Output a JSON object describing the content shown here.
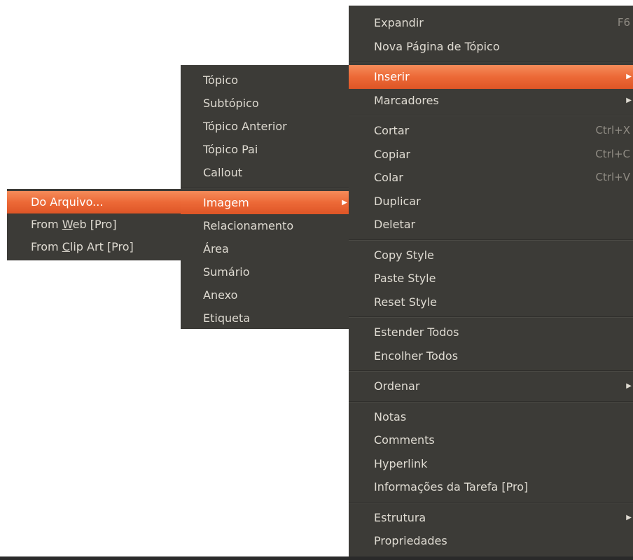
{
  "main_menu": {
    "items": [
      {
        "label": "Expandir",
        "shortcut": "F6"
      },
      {
        "label": "Nova Página de Tópico",
        "shortcut": ""
      },
      {
        "label": "Inserir",
        "submenu": true,
        "active": true
      },
      {
        "label": "Marcadores",
        "submenu": true
      },
      {
        "label": "Cortar",
        "shortcut": "Ctrl+X"
      },
      {
        "label": "Copiar",
        "shortcut": "Ctrl+C"
      },
      {
        "label": "Colar",
        "shortcut": "Ctrl+V"
      },
      {
        "label": "Duplicar"
      },
      {
        "label": "Deletar"
      },
      {
        "label": "Copy Style"
      },
      {
        "label": "Paste Style"
      },
      {
        "label": "Reset Style"
      },
      {
        "label": "Estender Todos"
      },
      {
        "label": "Encolher Todos"
      },
      {
        "label": "Ordenar",
        "submenu": true
      },
      {
        "label": "Notas"
      },
      {
        "label": "Comments"
      },
      {
        "label": "Hyperlink"
      },
      {
        "label": "Informações da Tarefa [Pro]"
      },
      {
        "label": "Estrutura",
        "submenu": true
      },
      {
        "label": "Propriedades"
      }
    ]
  },
  "inserir_menu": {
    "items": [
      {
        "label": "Tópico"
      },
      {
        "label": "Subtópico"
      },
      {
        "label": "Tópico Anterior"
      },
      {
        "label": "Tópico Pai"
      },
      {
        "label": "Callout"
      },
      {
        "label": "Imagem",
        "submenu": true,
        "active": true
      },
      {
        "label": "Relacionamento"
      },
      {
        "label": "Área"
      },
      {
        "label": "Sumário"
      },
      {
        "label": "Anexo"
      },
      {
        "label": "Etiqueta"
      }
    ]
  },
  "imagem_menu": {
    "items": [
      {
        "label": "Do Arquivo...",
        "active": true
      },
      {
        "label_pre": "From ",
        "label_ul": "W",
        "label_post": "eb [Pro]"
      },
      {
        "label_pre": "From ",
        "label_ul": "C",
        "label_post": "lip Art [Pro]"
      }
    ]
  },
  "icons": {
    "submenu_arrow": "▶"
  },
  "colors": {
    "menu_bg": "#3c3b37",
    "menu_text": "#dfdbd2",
    "highlight": "#ec6937",
    "shortcut_text": "#8f8b83"
  }
}
